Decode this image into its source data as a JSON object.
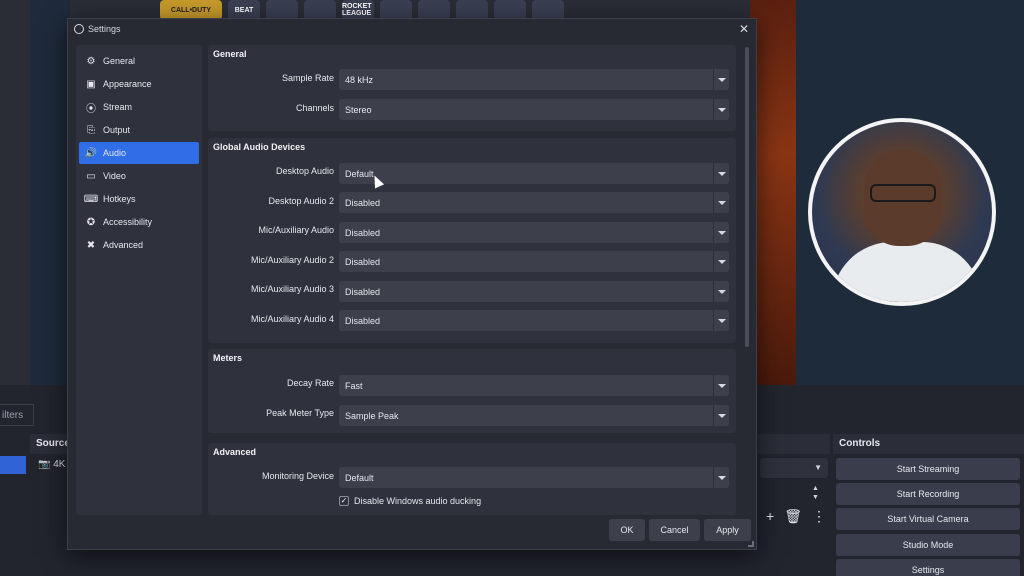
{
  "background": {
    "shelf_tiles": [
      "CALL•DUTY",
      "BEAT",
      "",
      "",
      "ROCKET LEAGUE",
      "",
      "",
      "",
      "",
      ""
    ],
    "filters_label": "ilters",
    "sources_header": "Sources",
    "source_item": "4K",
    "controls_header": "Controls",
    "controls": [
      "Start Streaming",
      "Start Recording",
      "Start Virtual Camera",
      "Studio Mode",
      "Settings"
    ]
  },
  "dialog": {
    "title": "Settings",
    "close_glyph": "✕"
  },
  "sidebar": {
    "items": [
      {
        "label": "General",
        "icon": "gear-icon",
        "glyph": "⚙",
        "active": false
      },
      {
        "label": "Appearance",
        "icon": "appearance-icon",
        "glyph": "▣",
        "active": false
      },
      {
        "label": "Stream",
        "icon": "stream-icon",
        "glyph": "⦿",
        "active": false
      },
      {
        "label": "Output",
        "icon": "output-icon",
        "glyph": "⎘",
        "active": false
      },
      {
        "label": "Audio",
        "icon": "speaker-icon",
        "glyph": "🔊",
        "active": true
      },
      {
        "label": "Video",
        "icon": "monitor-icon",
        "glyph": "▭",
        "active": false
      },
      {
        "label": "Hotkeys",
        "icon": "keyboard-icon",
        "glyph": "⌨",
        "active": false
      },
      {
        "label": "Accessibility",
        "icon": "accessibility-icon",
        "glyph": "✪",
        "active": false
      },
      {
        "label": "Advanced",
        "icon": "wrench-icon",
        "glyph": "✖",
        "active": false
      }
    ]
  },
  "sections": {
    "general": {
      "title": "General",
      "sample_rate_label": "Sample Rate",
      "sample_rate_value": "48 kHz",
      "channels_label": "Channels",
      "channels_value": "Stereo"
    },
    "global_audio": {
      "title": "Global Audio Devices",
      "desktop_audio_label": "Desktop Audio",
      "desktop_audio_value": "Default",
      "desktop_audio_2_label": "Desktop Audio 2",
      "desktop_audio_2_value": "Disabled",
      "mic_1_label": "Mic/Auxiliary Audio",
      "mic_1_value": "Disabled",
      "mic_2_label": "Mic/Auxiliary Audio 2",
      "mic_2_value": "Disabled",
      "mic_3_label": "Mic/Auxiliary Audio 3",
      "mic_3_value": "Disabled",
      "mic_4_label": "Mic/Auxiliary Audio 4",
      "mic_4_value": "Disabled"
    },
    "meters": {
      "title": "Meters",
      "decay_rate_label": "Decay Rate",
      "decay_rate_value": "Fast",
      "peak_meter_label": "Peak Meter Type",
      "peak_meter_value": "Sample Peak"
    },
    "advanced": {
      "title": "Advanced",
      "monitoring_label": "Monitoring Device",
      "monitoring_value": "Default",
      "ducking_label": "Disable Windows audio ducking",
      "ducking_checked": true
    }
  },
  "footer": {
    "ok": "OK",
    "cancel": "Cancel",
    "apply": "Apply"
  }
}
